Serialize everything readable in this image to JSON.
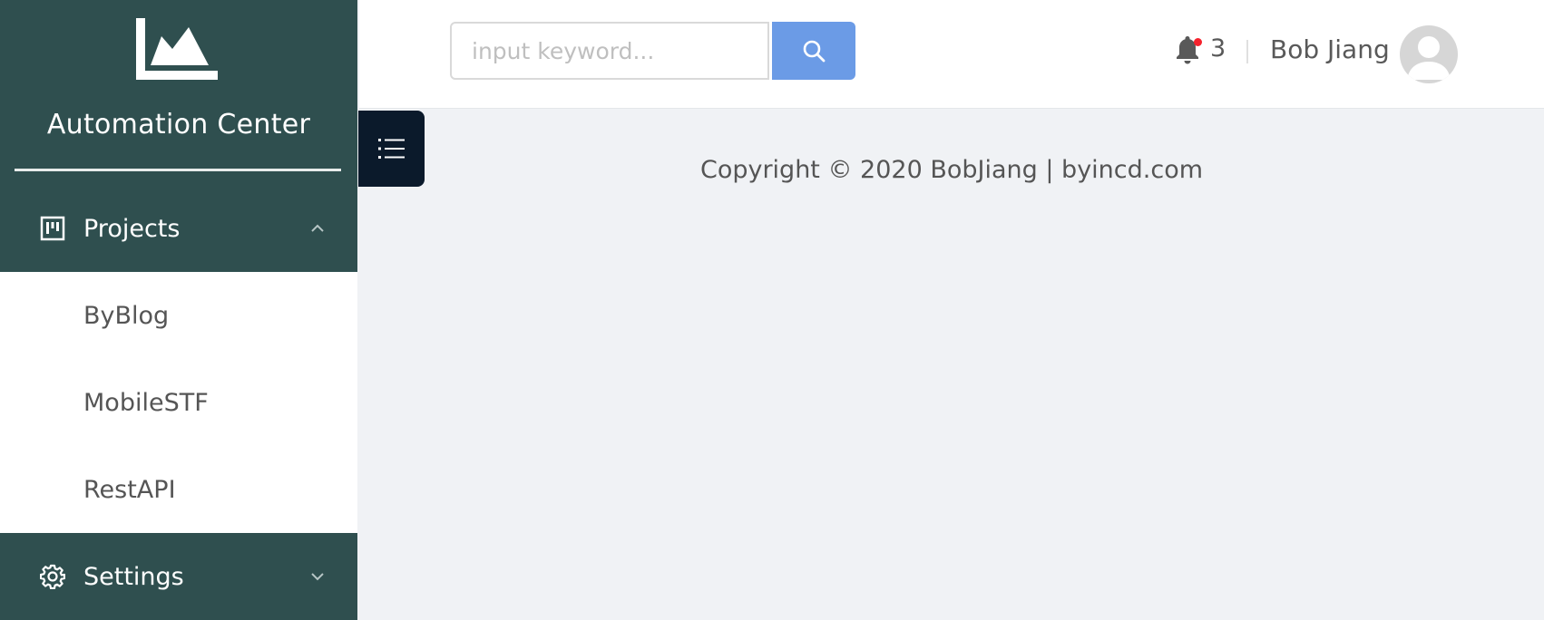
{
  "brand": {
    "title": "Automation Center",
    "logo_icon": "area-chart-icon"
  },
  "sidebar": {
    "groups": [
      {
        "label": "Projects",
        "icon": "project-board-icon",
        "expanded": true,
        "arrow_icon": "chevron-up-icon",
        "items": [
          {
            "label": "ByBlog"
          },
          {
            "label": "MobileSTF"
          },
          {
            "label": "RestAPI"
          }
        ]
      },
      {
        "label": "Settings",
        "icon": "gear-icon",
        "expanded": false,
        "arrow_icon": "chevron-down-icon"
      }
    ]
  },
  "header": {
    "search": {
      "placeholder": "input keyword...",
      "value": "",
      "button_icon": "search-icon"
    },
    "notifications": {
      "icon": "bell-icon",
      "count": "3"
    },
    "user": {
      "name": "Bob Jiang",
      "avatar_icon": "user-avatar-icon"
    }
  },
  "collapse_toggle": {
    "icon": "list-menu-icon"
  },
  "content": {
    "footer": "Copyright © 2020 BobJiang | byincd.com"
  },
  "colors": {
    "sidebar_bg": "#2f4f4f",
    "search_button": "#6b9be6",
    "toggle_bg": "#0b1a2b",
    "content_bg": "#f0f2f5",
    "badge_dot": "#f5222d"
  }
}
